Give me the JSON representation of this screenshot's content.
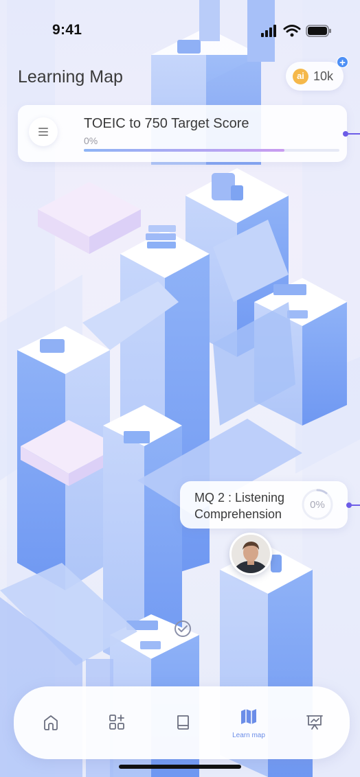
{
  "status_bar": {
    "time": "9:41",
    "icons": [
      "signal-icon",
      "wifi-icon",
      "battery-icon"
    ]
  },
  "header": {
    "title": "Learning Map",
    "coins": {
      "icon_label": "ai",
      "count": "10k",
      "add_icon": "plus-icon",
      "icon_color": "#f5b84a"
    }
  },
  "target": {
    "title": "TOEIC to 750 Target Score",
    "progress_text": "0%",
    "progress": 0,
    "menu_icon": "menu-icon"
  },
  "milestone": {
    "title": "MQ 2 : Listening Comprehension",
    "progress_text": "0%",
    "progress": 0
  },
  "map": {
    "completed_icon": "check-circle-icon",
    "avatar": "user-avatar"
  },
  "bottom_nav": {
    "items": [
      {
        "icon": "home-icon",
        "label": ""
      },
      {
        "icon": "grid-add-icon",
        "label": ""
      },
      {
        "icon": "book-icon",
        "label": ""
      },
      {
        "icon": "map-icon",
        "label": "Learn map",
        "active": true
      },
      {
        "icon": "presentation-chart-icon",
        "label": ""
      }
    ]
  },
  "colors": {
    "accent": "#6c5ce7",
    "nav_active": "#6b8de8",
    "tile_blue": "#8cb0f6"
  }
}
